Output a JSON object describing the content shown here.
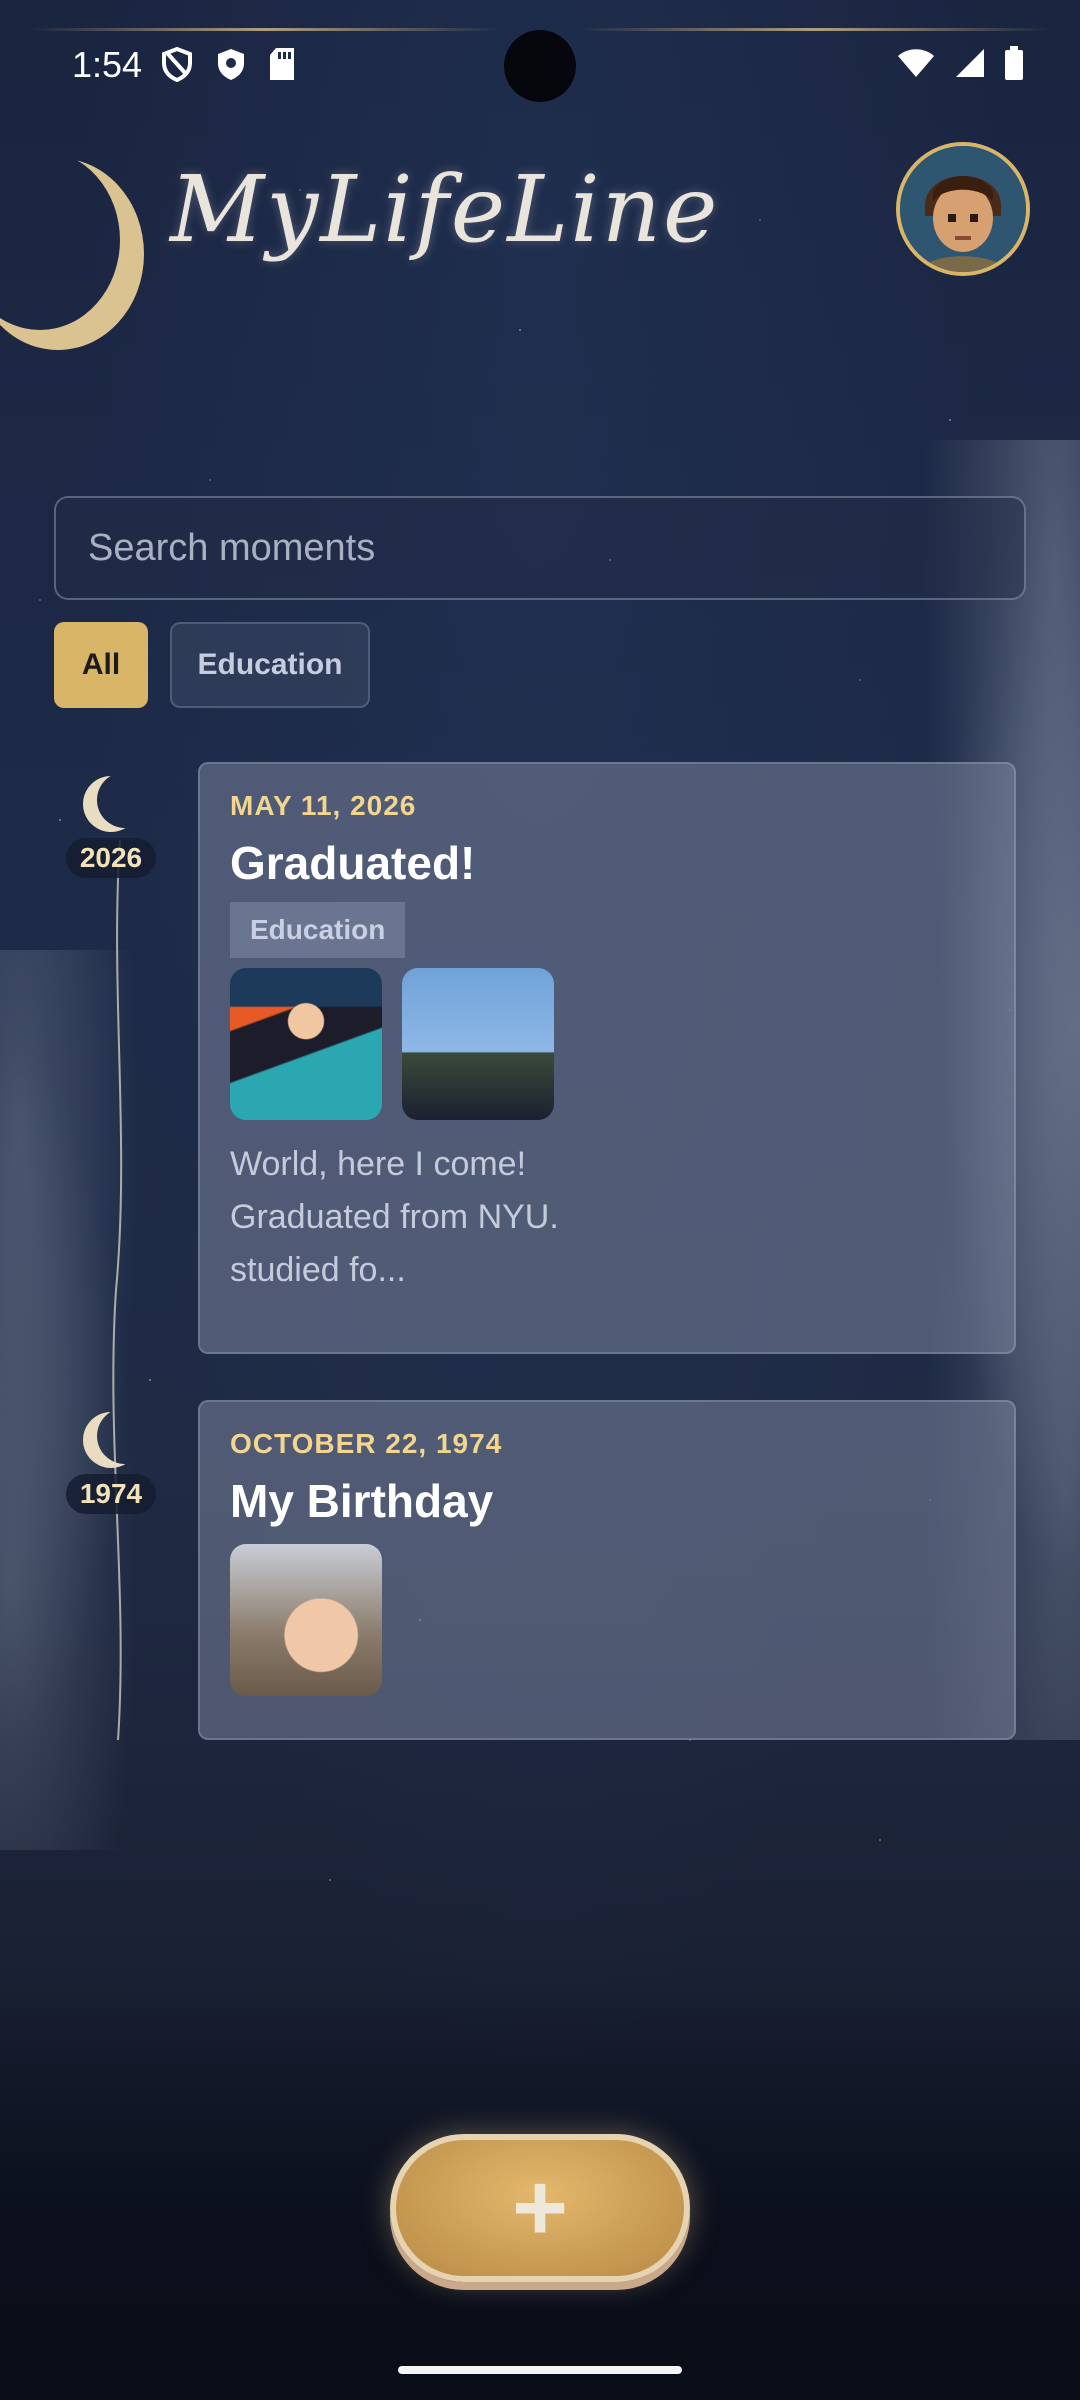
{
  "status_bar": {
    "time": "1:54",
    "left_icons": [
      "shield-outline-icon",
      "shield-filled-icon",
      "sd-card-icon"
    ],
    "right_icons": [
      "wifi-icon",
      "signal-icon",
      "battery-icon"
    ]
  },
  "header": {
    "app_title": "MyLifeLine",
    "avatar_icon": "user-avatar"
  },
  "search": {
    "placeholder": "Search moments",
    "value": ""
  },
  "filters": {
    "items": [
      {
        "label": "All",
        "selected": true
      },
      {
        "label": "Education",
        "selected": false
      }
    ]
  },
  "timeline": {
    "entries": [
      {
        "year": "2026",
        "date": "MAY 11, 2026",
        "title": "Graduated!",
        "tag": "Education",
        "photos": [
          "graduate-photo",
          "cap-toss-photo"
        ],
        "description": "World, here I come!\nGraduated from NYU.\nstudied fo..."
      },
      {
        "year": "1974",
        "date": "OCTOBER 22, 1974",
        "title": "My Birthday",
        "photos": [
          "baby-photo"
        ]
      }
    ]
  },
  "fab": {
    "icon": "plus-icon",
    "label": "+"
  },
  "colors": {
    "accent": "#d9b567",
    "date_text": "#f2d58e",
    "background": "#1d2a48"
  }
}
